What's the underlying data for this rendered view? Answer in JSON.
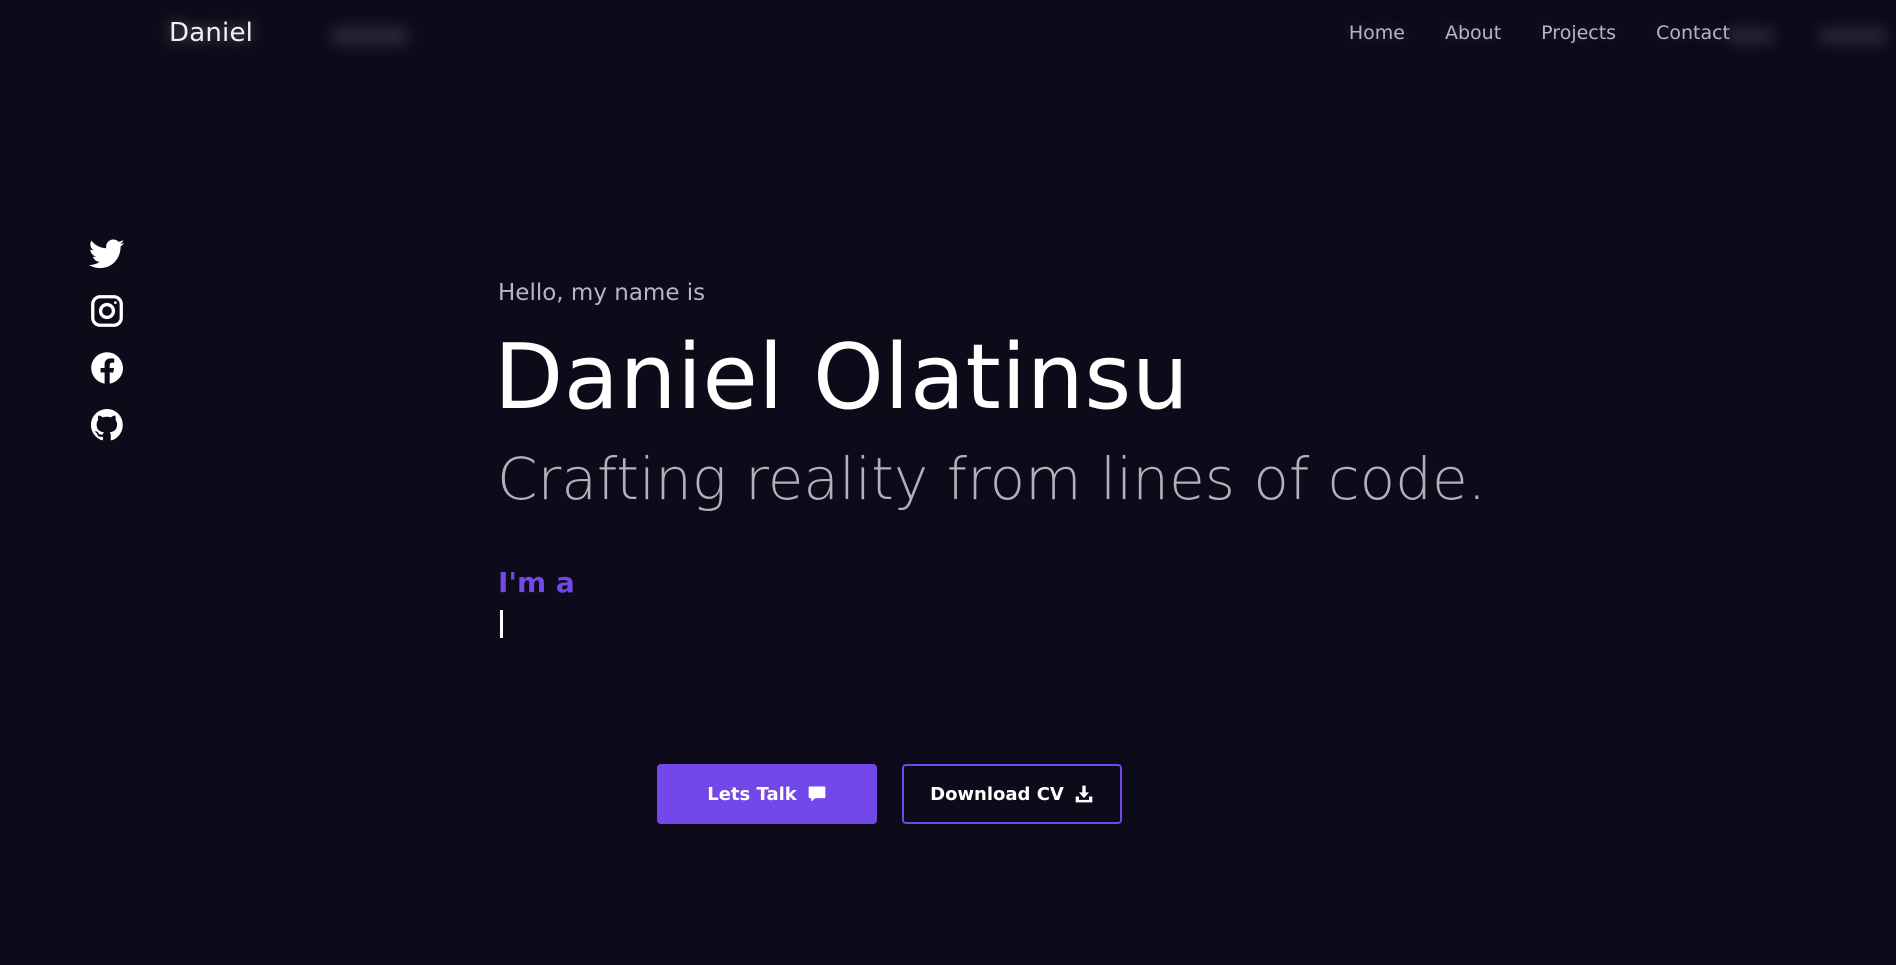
{
  "header": {
    "logo": "Daniel",
    "nav": [
      "Home",
      "About",
      "Projects",
      "Contact"
    ]
  },
  "socials": [
    {
      "name": "twitter-icon"
    },
    {
      "name": "instagram-icon"
    },
    {
      "name": "facebook-icon"
    },
    {
      "name": "github-icon"
    }
  ],
  "hero": {
    "greeting": "Hello, my name is",
    "name": "Daniel Olatinsu",
    "tagline": "Crafting reality from lines of code.",
    "role_prefix": "I'm a"
  },
  "buttons": {
    "talk_label": "Lets Talk",
    "talk_icon": "chat-icon",
    "cv_label": "Download CV",
    "cv_icon": "download-icon"
  },
  "colors": {
    "background": "#0d0a19",
    "accent": "#7447e8",
    "text": "#ffffff",
    "muted": "#b3b0bb"
  }
}
